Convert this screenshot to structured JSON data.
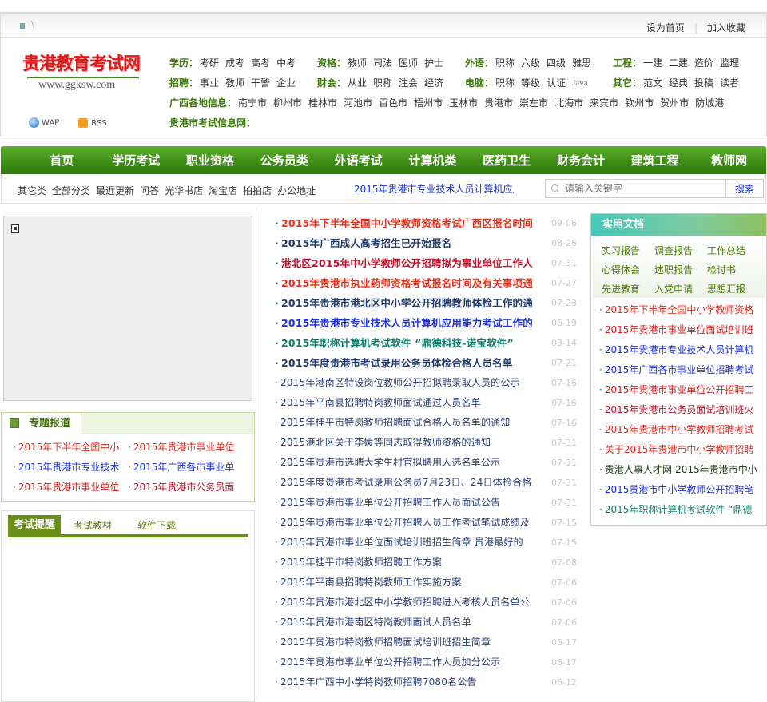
{
  "topbar": {
    "set_home": "设为首页",
    "bookmark": "加入收藏",
    "home_glyph": "\\"
  },
  "logo": {
    "title": "贵港教育考试网",
    "url": "www.ggksw.com"
  },
  "wap": "WAP",
  "rss": "RSS",
  "categories": [
    [
      {
        "label": "学历：",
        "items": [
          "考研",
          "成考",
          "高考",
          "中考"
        ]
      },
      {
        "label": "资格：",
        "items": [
          "教师",
          "司法",
          "医师",
          "护士"
        ]
      },
      {
        "label": "外语：",
        "items": [
          "职称",
          "六级",
          "四级",
          "雅思"
        ]
      },
      {
        "label": "工程：",
        "items": [
          "一建",
          "二建",
          "造价",
          "监理"
        ]
      }
    ],
    [
      {
        "label": "招聘：",
        "items": [
          "事业",
          "教师",
          "干警",
          "企业"
        ]
      },
      {
        "label": "财会：",
        "items": [
          "从业",
          "职称",
          "注会",
          "经济"
        ]
      },
      {
        "label": "电脑：",
        "items": [
          "职称",
          "等级",
          "认证",
          "Java"
        ]
      },
      {
        "label": "其它：",
        "items": [
          "范文",
          "经典",
          "投稿",
          "读者"
        ]
      }
    ],
    [
      {
        "label": "广西各地信息：",
        "items": [
          "南宁市",
          "柳州市",
          "桂林市",
          "河池市",
          "百色市",
          "梧州市",
          "玉林市",
          "贵港市",
          "崇左市",
          "北海市",
          "来宾市",
          "钦州市",
          "贺州市",
          "防城港"
        ]
      }
    ],
    [
      {
        "label": "贵港市考试信息网：",
        "items": []
      }
    ]
  ],
  "nav": [
    "首页",
    "学历考试",
    "职业资格",
    "公务员类",
    "外语考试",
    "计算机类",
    "医药卫生",
    "财务会计",
    "建筑工程",
    "教师网"
  ],
  "subnav": [
    "其它类",
    "全部分类",
    "最近更新",
    "问答",
    "光华书店",
    "淘宝店",
    "拍拍店",
    "办公地址"
  ],
  "marquee": "2015年贵港市专业技术人员计算机应用能力考试",
  "search": {
    "placeholder": "请输入关键字",
    "button": "搜索"
  },
  "topic": {
    "title": "专题报道",
    "items": [
      {
        "t": "2015年下半年全国中小",
        "c": "#e8281c"
      },
      {
        "t": "2015年贵港市事业单位",
        "c": "#e8281c"
      },
      {
        "t": "2015年贵港市专业技术",
        "c": "#1a2ee0"
      },
      {
        "t": "2015年广西各市事业单",
        "c": "#1a2ee0"
      },
      {
        "t": "2015年贵港市事业单位",
        "c": "#d0201c"
      },
      {
        "t": "2015年贵港市公务员面",
        "c": "#c0102a"
      }
    ]
  },
  "tabs": [
    "考试提醒",
    "考试教材",
    "软件下载"
  ],
  "news": [
    {
      "t": "2015年下半年全国中小学教师资格考试广西区报名时间",
      "d": "09-06",
      "c": "#e8301c",
      "b": true
    },
    {
      "t": "2015年广西成人高考招生已开始报名",
      "d": "08-26",
      "c": "#213a6e",
      "b": true
    },
    {
      "t": "港北区2015年中小学教师公开招聘拟为事业单位工作人",
      "d": "07-31",
      "c": "#c0102a",
      "b": true
    },
    {
      "t": "2015年贵港市执业药师资格考试报名时间及有关事项通",
      "d": "07-27",
      "c": "#e8301c",
      "b": true
    },
    {
      "t": "2015年贵港市港北区中小学公开招聘教师体检工作的通",
      "d": "07-23",
      "c": "#213a6e",
      "b": true
    },
    {
      "t": "2015年贵港市专业技术人员计算机应用能力考试工作的",
      "d": "06-19",
      "c": "#1a2ee0",
      "b": true
    },
    {
      "t": "2015年职称计算机考试软件 “鼎德科技-诺宝软件”",
      "d": "03-14",
      "c": "#0d7d6d",
      "b": true
    },
    {
      "t": "2015年度贵港市考试录用公务员体检合格人员名单",
      "d": "07-21",
      "c": "#213a6e",
      "b": true
    },
    {
      "t": "2015年港南区特设岗位教师公开招拟聘录取人员的公示",
      "d": "07-16"
    },
    {
      "t": "2015年平南县招聘特岗教师面试通过人员名单",
      "d": "07-16"
    },
    {
      "t": "2015年桂平市特岗教师招聘面试合格人员名单的通知",
      "d": "07-16"
    },
    {
      "t": "2015港北区关于李媛等同志取得教师资格的通知",
      "d": "07-31"
    },
    {
      "t": "2015年贵港市选聘大学生村官拟聘用人选名单公示",
      "d": "07-31"
    },
    {
      "t": "2015年度贵港市考试录用公务员7月23日、24日体检合格",
      "d": "07-31"
    },
    {
      "t": "2015年贵港市事业单位公开招聘工作人员面试公告",
      "d": "07-31"
    },
    {
      "t": "2015年贵港市事业单位公开招聘人员工作考试笔试成绩及",
      "d": "07-15"
    },
    {
      "t": "2015年贵港市事业单位面试培训班招生简章 贵港最好的",
      "d": "07-15"
    },
    {
      "t": "2015年桂平市特岗教师招聘工作方案",
      "d": "07-08"
    },
    {
      "t": "2015年平南县招聘特岗教师工作实施方案",
      "d": "07-06"
    },
    {
      "t": "2015年贵港市港北区中小学教师招聘进入考核人员名单公",
      "d": "07-06"
    },
    {
      "t": "2015年贵港市港南区特岗教师面试人员名单",
      "d": "07-06"
    },
    {
      "t": "2015年贵港市特岗教师招聘面试培训班招生简章",
      "d": "06-17"
    },
    {
      "t": "2015年贵港市事业单位公开招聘工作人员加分公示",
      "d": "06-17"
    },
    {
      "t": "2015年广西中小学特岗教师招聘7080名公告",
      "d": "06-12"
    }
  ],
  "docs": {
    "title": "实用文档",
    "links": [
      "实习报告",
      "调查报告",
      "工作总结",
      "心得体会",
      "述职报告",
      "检讨书",
      "先进教育",
      "入党申请",
      "思想汇报"
    ],
    "items": [
      {
        "t": "2015年下半年全国中小学教师资格",
        "c": "#e8281c"
      },
      {
        "t": "2015年贵港市事业单位面试培训班",
        "c": "#e01818"
      },
      {
        "t": "2015年贵港市专业技术人员计算机",
        "c": "#1a2ee0"
      },
      {
        "t": "2015年广西各市事业单位招聘考试",
        "c": "#1a2ee0"
      },
      {
        "t": "2015年贵港市事业单位公开招聘工",
        "c": "#d0201c"
      },
      {
        "t": "2015年贵港市公务员面试培训班火",
        "c": "#c0102a"
      },
      {
        "t": "2015年贵港市中小学教师招聘考试",
        "c": "#e8281c"
      },
      {
        "t": "关于2015年贵港市中小学教师招聘",
        "c": "#e8281c"
      },
      {
        "t": "贵港人事人才网-2015年贵港市中小",
        "c": "#1a3a10"
      },
      {
        "t": "2015贵港市中小学教师公开招聘笔",
        "c": "#1a2ee0"
      },
      {
        "t": "2015年职称计算机考试软件 “鼎德",
        "c": "#0d7d6d"
      }
    ]
  }
}
